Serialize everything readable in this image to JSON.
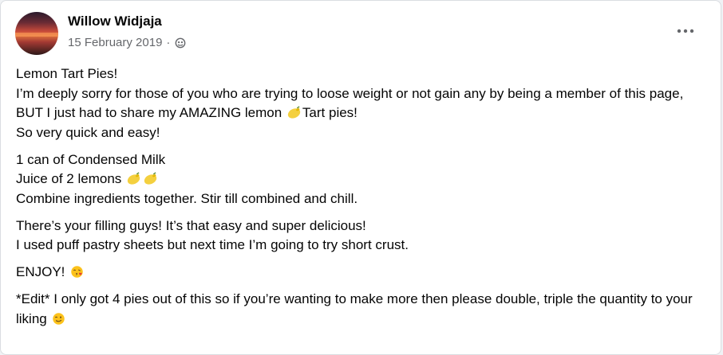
{
  "post": {
    "author": "Willow Widjaja",
    "date": "15 February 2019",
    "separator": "·",
    "privacy_icon": "globe-icon",
    "more_icon": "more-options-icon"
  },
  "body": {
    "p1": {
      "title": "Lemon Tart Pies!",
      "l2": "I’m deeply sorry for those of you who are trying to loose weight or not gain any by being a member of this page, BUT I just had to share my AMAZING lemon ",
      "l2_emoji": "lemon-emoji",
      "l2_tail": "Tart pies!",
      "l3": "So very quick and easy!"
    },
    "p2": {
      "l1": "1 can of Condensed Milk",
      "l2": "Juice of 2 lemons ",
      "l2_emojis": [
        "lemon-emoji",
        "lemon-emoji"
      ],
      "l3": "Combine ingredients together. Stir till combined and chill."
    },
    "p3": {
      "l1": "There’s your filling guys! It’s that easy and super delicious!",
      "l2": "I used puff pastry sheets but next time I’m going to try short crust."
    },
    "p4": {
      "l1": "ENJOY! ",
      "emoji": "kissing-heart-emoji"
    },
    "p5": {
      "l1": "*Edit* I only got 4 pies out of this so if you’re wanting to make more then please double, triple the quantity to your liking ",
      "emoji": "winking-face-emoji"
    }
  },
  "colors": {
    "text": "#050505",
    "secondary_text": "#65676b",
    "lemon": "#f4d03f"
  }
}
